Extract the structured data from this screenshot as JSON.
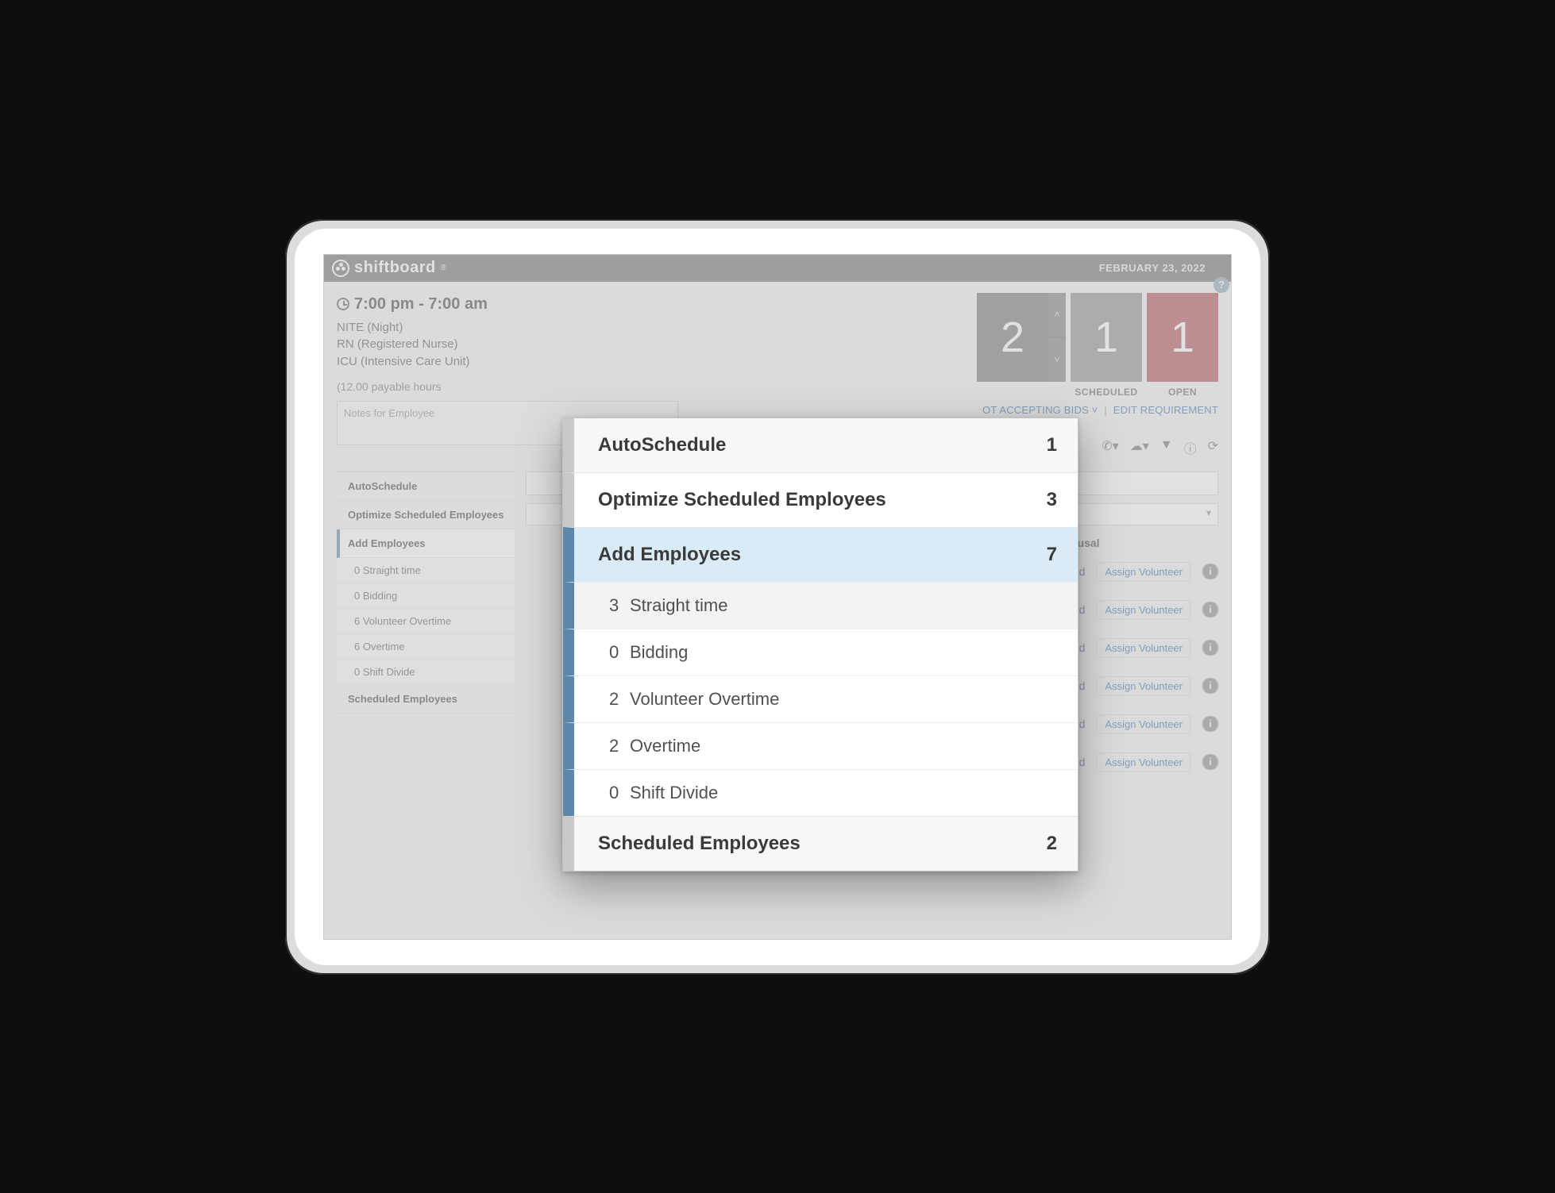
{
  "brand": "shiftboard",
  "date": "FEBRUARY 23, 2022",
  "shift": {
    "time": "7:00 pm - 7:00 am",
    "lines": [
      "NITE (Night)",
      "RN (Registered Nurse)",
      "ICU (Intensive Care Unit)"
    ],
    "payable": "(12.00 payable hours",
    "notes_placeholder": "Notes for Employee"
  },
  "counters": {
    "required": {
      "value": "2",
      "label": ""
    },
    "scheduled": {
      "value": "1",
      "label": "SCHEDULED"
    },
    "open": {
      "value": "1",
      "label": "OPEN"
    }
  },
  "header_links": {
    "bids": "OT ACCEPTING BIDS ˅",
    "edit": "EDIT REQUIREMENT"
  },
  "sidebar": {
    "auto": "AutoSchedule",
    "optimize": "Optimize Scheduled Employees",
    "add": "Add Employees",
    "subs": [
      "0 Straight time",
      "0 Bidding",
      "6 Volunteer Overtime",
      "6 Overtime",
      "0 Shift Divide"
    ],
    "sched": "Scheduled Employees"
  },
  "main": {
    "refusal": "Refusal",
    "add_link": "Add",
    "assign_pill": "Assign Volunteer",
    "rows": 6
  },
  "popover": {
    "rows": [
      {
        "label": "AutoSchedule",
        "count": "1",
        "style": "gray"
      },
      {
        "label": "Optimize Scheduled Employees",
        "count": "3",
        "style": "white"
      },
      {
        "label": "Add Employees",
        "count": "7",
        "style": "active"
      }
    ],
    "subs": [
      {
        "n": "3",
        "label": "Straight time",
        "shade": true
      },
      {
        "n": "0",
        "label": "Bidding",
        "shade": false
      },
      {
        "n": "2",
        "label": "Volunteer Overtime",
        "shade": false
      },
      {
        "n": "2",
        "label": "Overtime",
        "shade": false
      },
      {
        "n": "0",
        "label": "Shift Divide",
        "shade": false
      }
    ],
    "footer": {
      "label": "Scheduled Employees",
      "count": "2"
    }
  }
}
